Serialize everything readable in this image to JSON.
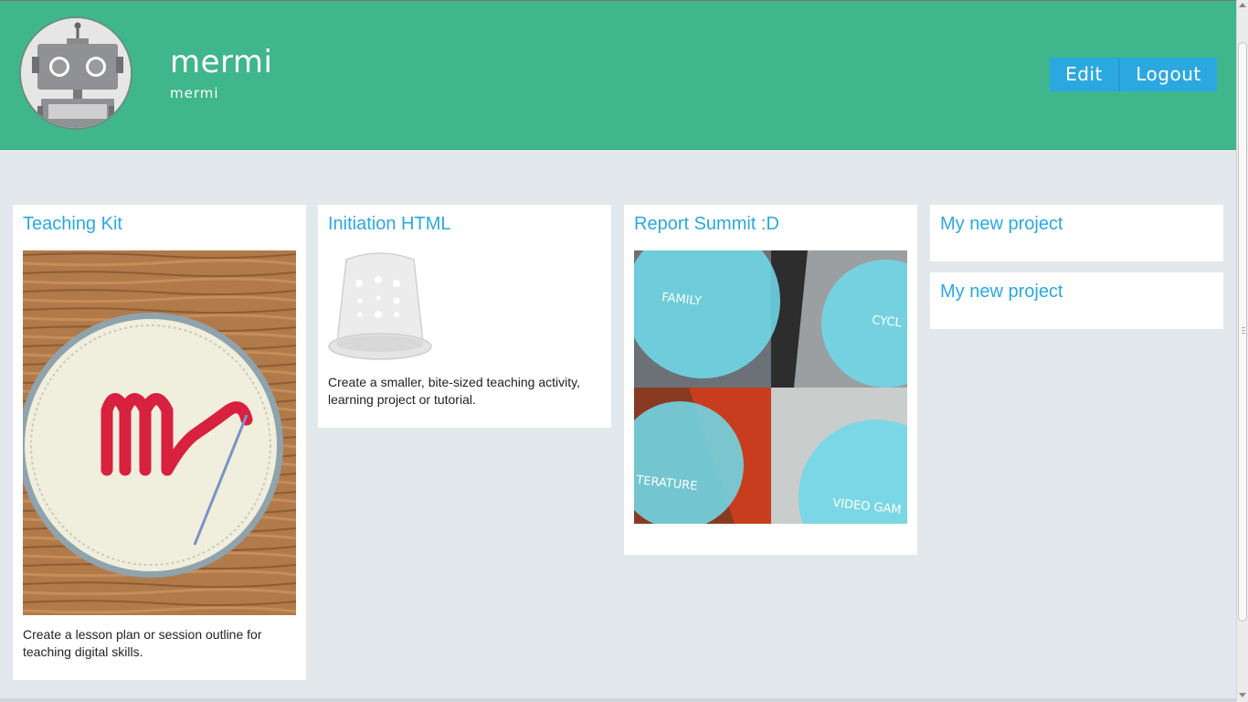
{
  "header": {
    "user_name": "mermi",
    "user_handle": "mermi",
    "edit_label": "Edit",
    "logout_label": "Logout",
    "bg_color": "#3fb68c",
    "button_color": "#2ba8e0"
  },
  "projects": [
    {
      "title": "Teaching Kit",
      "description": "Create a lesson plan or session outline for teaching digital skills.",
      "thumbnail": "maker-badge-patch"
    },
    {
      "title": "Initiation HTML",
      "description": "Create a smaller, bite-sized teaching activity, learning project or tutorial.",
      "thumbnail": "thimble-icon"
    },
    {
      "title": "Report Summit :D",
      "description": "",
      "thumbnail": "topic-collage",
      "collage_labels": [
        "FAMILY",
        "CYCL",
        "TERATURE",
        "VIDEO GAM"
      ]
    },
    {
      "title": "My new project"
    },
    {
      "title": "My new project"
    }
  ],
  "link_color": "#2ba8e0",
  "page_bg": "#e2e8eb"
}
